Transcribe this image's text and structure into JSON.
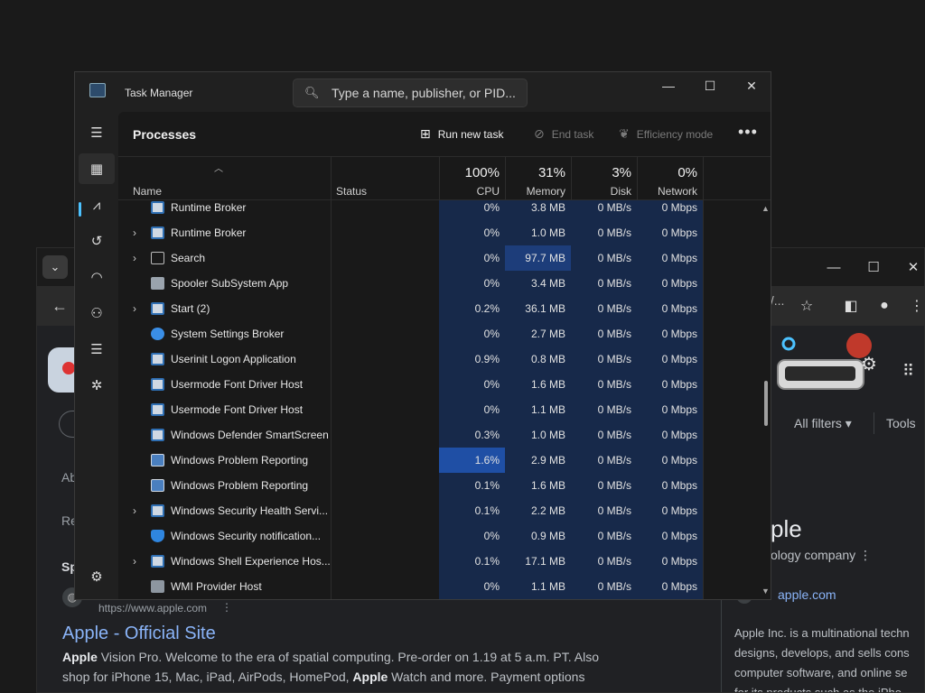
{
  "browser": {
    "menu_glyph": "⌄",
    "omnibox_tail": "\\/...",
    "search_tools": {
      "all_filters": "All filters ▾",
      "tools": "Tools"
    },
    "sidebar_snippets": [
      "Ab",
      "Re",
      "Sp"
    ],
    "result": {
      "url": "https://www.apple.com",
      "title": "Apple - Official Site",
      "snippet_line1_a": "Apple",
      "snippet_line1_b": " Vision Pro. Welcome to the era of spatial computing. Pre-order on 1.19 at 5 a.m. PT. Also",
      "snippet_line2_a": "shop for iPhone 15, Mac, iPad, AirPods, HomePod, ",
      "snippet_line2_b": "Apple",
      "snippet_line2_c": " Watch and more. Payment options"
    },
    "knowledge_panel": {
      "title": "ple",
      "subtitle": "ology company ⋮",
      "link": "apple.com",
      "desc_lines": [
        "Apple Inc. is a multinational techn",
        "designs, develops, and sells cons",
        "computer software, and online se",
        "for its products such as the iPho"
      ]
    }
  },
  "tm": {
    "title": "Task Manager",
    "search_placeholder": "Type a name, publisher, or PID...",
    "page_title": "Processes",
    "commands": {
      "run_new_task": "Run new task",
      "end_task": "End task",
      "efficiency_mode": "Efficiency mode"
    },
    "columns": {
      "name": "Name",
      "status": "Status",
      "cpu_pct": "100%",
      "cpu": "CPU",
      "mem_pct": "31%",
      "mem": "Memory",
      "disk_pct": "3%",
      "disk": "Disk",
      "net_pct": "0%",
      "net": "Network"
    },
    "colors": {
      "accent": "#4cc2ff",
      "heat_low": "#17294a",
      "heat_mid": "#1d3d7a",
      "heat_high": "#1f4fa5"
    },
    "processes": [
      {
        "name": "Runtime Broker",
        "expand": false,
        "icon": "app-window-icon",
        "cpu": "0%",
        "memory": "3.8 MB",
        "disk": "0 MB/s",
        "network": "0 Mbps"
      },
      {
        "name": "Runtime Broker",
        "expand": true,
        "icon": "app-window-icon",
        "cpu": "0%",
        "memory": "1.0 MB",
        "disk": "0 MB/s",
        "network": "0 Mbps"
      },
      {
        "name": "Search",
        "expand": true,
        "icon": "search-app-icon",
        "cpu": "0%",
        "memory": "97.7 MB",
        "disk": "0 MB/s",
        "network": "0 Mbps",
        "mem_hot": true
      },
      {
        "name": "Spooler SubSystem App",
        "expand": false,
        "icon": "printer-icon",
        "cpu": "0%",
        "memory": "3.4 MB",
        "disk": "0 MB/s",
        "network": "0 Mbps"
      },
      {
        "name": "Start (2)",
        "expand": true,
        "icon": "app-window-icon",
        "cpu": "0.2%",
        "memory": "36.1 MB",
        "disk": "0 MB/s",
        "network": "0 Mbps"
      },
      {
        "name": "System Settings Broker",
        "expand": false,
        "icon": "settings-gear-icon",
        "cpu": "0%",
        "memory": "2.7 MB",
        "disk": "0 MB/s",
        "network": "0 Mbps"
      },
      {
        "name": "Userinit Logon Application",
        "expand": false,
        "icon": "app-window-icon",
        "cpu": "0.9%",
        "memory": "0.8 MB",
        "disk": "0 MB/s",
        "network": "0 Mbps"
      },
      {
        "name": "Usermode Font Driver Host",
        "expand": false,
        "icon": "app-window-icon",
        "cpu": "0%",
        "memory": "1.6 MB",
        "disk": "0 MB/s",
        "network": "0 Mbps"
      },
      {
        "name": "Usermode Font Driver Host",
        "expand": false,
        "icon": "app-window-icon",
        "cpu": "0%",
        "memory": "1.1 MB",
        "disk": "0 MB/s",
        "network": "0 Mbps"
      },
      {
        "name": "Windows Defender SmartScreen",
        "expand": false,
        "icon": "app-window-icon",
        "cpu": "0.3%",
        "memory": "1.0 MB",
        "disk": "0 MB/s",
        "network": "0 Mbps"
      },
      {
        "name": "Windows Problem Reporting",
        "expand": false,
        "icon": "problem-report-icon",
        "cpu": "1.6%",
        "memory": "2.9 MB",
        "disk": "0 MB/s",
        "network": "0 Mbps",
        "cpu_hot": true
      },
      {
        "name": "Windows Problem Reporting",
        "expand": false,
        "icon": "problem-report-icon",
        "cpu": "0.1%",
        "memory": "1.6 MB",
        "disk": "0 MB/s",
        "network": "0 Mbps"
      },
      {
        "name": "Windows Security Health Servi...",
        "expand": true,
        "icon": "app-window-icon",
        "cpu": "0.1%",
        "memory": "2.2 MB",
        "disk": "0 MB/s",
        "network": "0 Mbps"
      },
      {
        "name": "Windows Security notification...",
        "expand": false,
        "icon": "shield-icon",
        "cpu": "0%",
        "memory": "0.9 MB",
        "disk": "0 MB/s",
        "network": "0 Mbps"
      },
      {
        "name": "Windows Shell Experience Hos...",
        "expand": true,
        "icon": "app-window-icon",
        "cpu": "0.1%",
        "memory": "17.1 MB",
        "disk": "0 MB/s",
        "network": "0 Mbps"
      },
      {
        "name": "WMI Provider Host",
        "expand": false,
        "icon": "wmi-host-icon",
        "cpu": "0%",
        "memory": "1.1 MB",
        "disk": "0 MB/s",
        "network": "0 Mbps"
      }
    ]
  }
}
